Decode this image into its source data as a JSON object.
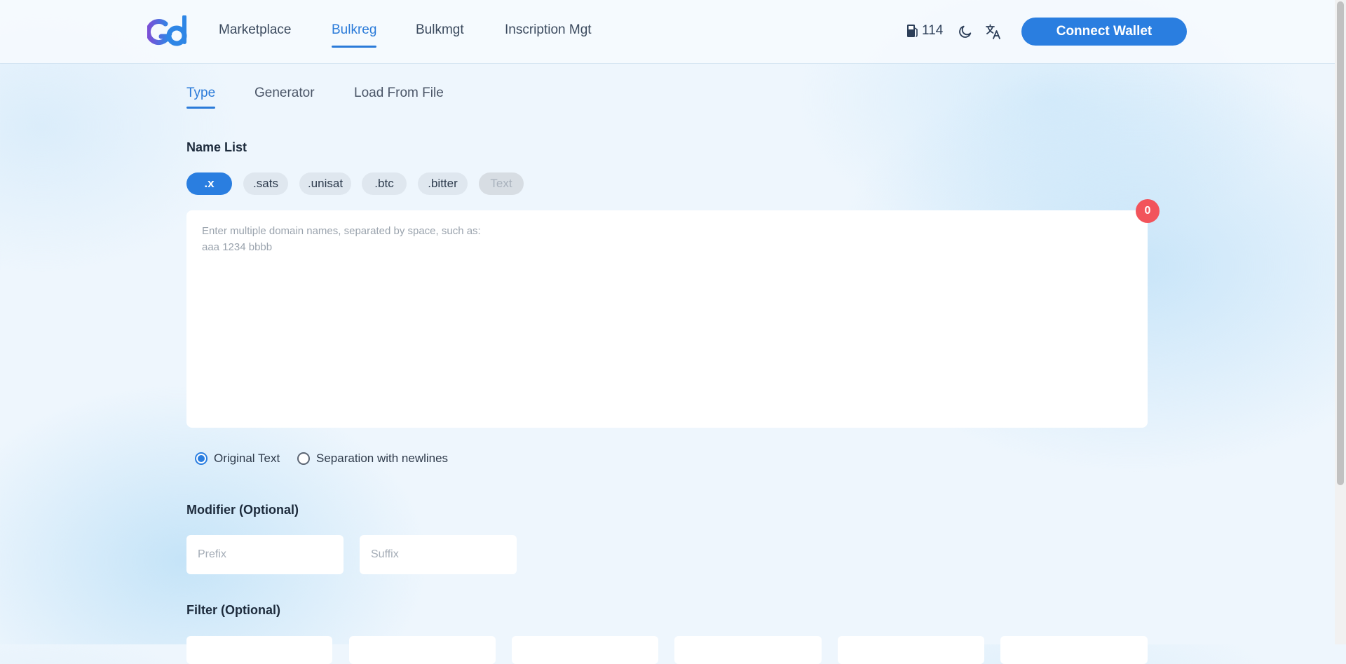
{
  "header": {
    "nav": [
      {
        "label": "Marketplace"
      },
      {
        "label": "Bulkreg",
        "active": true
      },
      {
        "label": "Bulkmgt"
      },
      {
        "label": "Inscription Mgt"
      }
    ],
    "gas_value": "114",
    "connect_wallet_label": "Connect Wallet"
  },
  "tabs": [
    {
      "label": "Type",
      "active": true
    },
    {
      "label": "Generator"
    },
    {
      "label": "Load From File"
    }
  ],
  "name_list": {
    "title": "Name List",
    "suffixes": [
      {
        "label": ".x",
        "active": true
      },
      {
        "label": ".sats"
      },
      {
        "label": ".unisat"
      },
      {
        "label": ".btc"
      },
      {
        "label": ".bitter"
      },
      {
        "label": "Text",
        "disabled": true
      }
    ],
    "placeholder": "Enter multiple domain names, separated by space, such as:\naaa 1234 bbbb",
    "value": "",
    "count": "0"
  },
  "separation_options": [
    {
      "label": "Original Text",
      "checked": true
    },
    {
      "label": "Separation with newlines",
      "checked": false
    }
  ],
  "modifier": {
    "title": "Modifier (Optional)",
    "prefix_placeholder": "Prefix",
    "suffix_placeholder": "Suffix"
  },
  "filter": {
    "title": "Filter (Optional)"
  },
  "colors": {
    "accent": "#2a7ee0",
    "badge": "#f2545b"
  },
  "icons": {
    "gas": "gas-pump-icon",
    "theme": "moon-icon",
    "language": "translate-icon"
  }
}
